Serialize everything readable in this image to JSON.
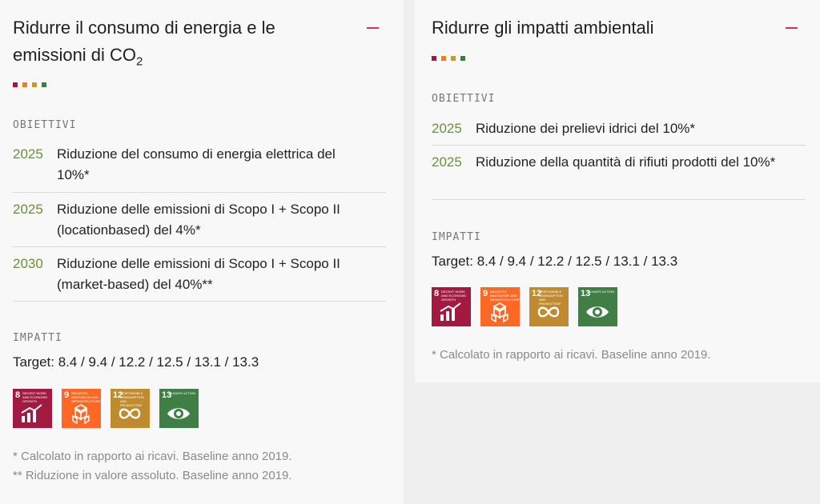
{
  "left_card": {
    "title_line1": "Ridurre il consumo di energia e le",
    "title_line2_prefix": "emissioni di CO",
    "title_line2_sub": "2",
    "dot_colors": [
      "#9b1b45",
      "#ef7d22",
      "#c69a30",
      "#3d7f3a"
    ],
    "objectives_label": "OBIETTIVI",
    "goals": [
      {
        "year": "2025",
        "text": "Riduzione del consumo di energia elettrica del 10%*"
      },
      {
        "year": "2025",
        "text": "Riduzione delle emissioni di Scopo I + Scopo II (locationbased) del 4%*"
      },
      {
        "year": "2030",
        "text": "Riduzione delle emissioni di Scopo I + Scopo II (market-based) del 40%**"
      }
    ],
    "impacts_label": "IMPATTI",
    "target": "Target: 8.4 / 9.4 / 12.2 / 12.5 / 13.1 / 13.3",
    "footnotes": [
      "* Calcolato in rapporto ai ricavi. Baseline anno 2019.",
      "** Riduzione in valore assoluto. Baseline anno 2019."
    ]
  },
  "right_card": {
    "title": "Ridurre gli impatti ambientali",
    "dot_colors": [
      "#9b1b45",
      "#ef7d22",
      "#c69a30",
      "#3d7f3a"
    ],
    "objectives_label": "OBIETTIVI",
    "goals": [
      {
        "year": "2025",
        "text": "Riduzione dei prelievi idrici del 10%*"
      },
      {
        "year": "2025",
        "text": "Riduzione della quantità di rifiuti prodotti del 10%*"
      }
    ],
    "impacts_label": "IMPATTI",
    "target": "Target: 8.4 / 9.4 / 12.2 / 12.5 / 13.1 / 13.3",
    "footnotes": [
      "* Calcolato in rapporto ai ricavi. Baseline anno 2019."
    ]
  },
  "sdg_icons": [
    {
      "number": "8",
      "caption": "Decent work and economic growth",
      "color": "#a21942",
      "icon": "growth-chart-icon"
    },
    {
      "number": "9",
      "caption": "Industry, innovation and infrastructure",
      "color": "#fd6925",
      "icon": "cubes-icon"
    },
    {
      "number": "12",
      "caption": "Responsible consumption and production",
      "color": "#bf8b2e",
      "icon": "infinity-icon"
    },
    {
      "number": "13",
      "caption": "Climate action",
      "color": "#3f7e44",
      "icon": "eye-globe-icon"
    }
  ],
  "accent_color": "#e0324b",
  "year_color": "#6b8f3e"
}
